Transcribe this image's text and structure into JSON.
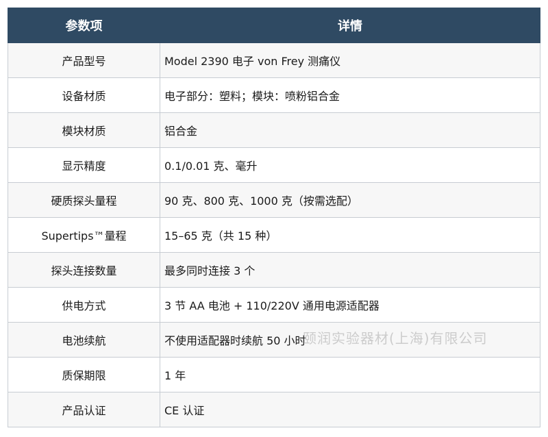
{
  "table": {
    "header": {
      "param": "参数项",
      "detail": "详情"
    },
    "rows": [
      {
        "param": "产品型号",
        "detail": "Model 2390 电子 von Frey 测痛仪"
      },
      {
        "param": "设备材质",
        "detail": "电子部分：塑料；模块：喷粉铝合金"
      },
      {
        "param": "模块材质",
        "detail": "铝合金"
      },
      {
        "param": "显示精度",
        "detail": "0.1/0.01 克、毫升"
      },
      {
        "param": "硬质探头量程",
        "detail": "90 克、800 克、1000 克（按需选配）"
      },
      {
        "param": "Supertips™量程",
        "detail": "15–65 克（共 15 种）"
      },
      {
        "param": "探头连接数量",
        "detail": "最多同时连接 3 个"
      },
      {
        "param": "供电方式",
        "detail": "3 节 AA 电池 + 110/220V 通用电源适配器"
      },
      {
        "param": "电池续航",
        "detail": "不使用适配器时续航 50 小时"
      },
      {
        "param": "质保期限",
        "detail": "1 年"
      },
      {
        "param": "产品认证",
        "detail": "CE 认证"
      }
    ]
  },
  "watermark": "颐润实验器材(上海)有限公司",
  "colors": {
    "header_bg": "#2f4a63",
    "header_text": "#ffffff",
    "border": "#c7ccd2",
    "row_alt": "#f7f7f7"
  }
}
